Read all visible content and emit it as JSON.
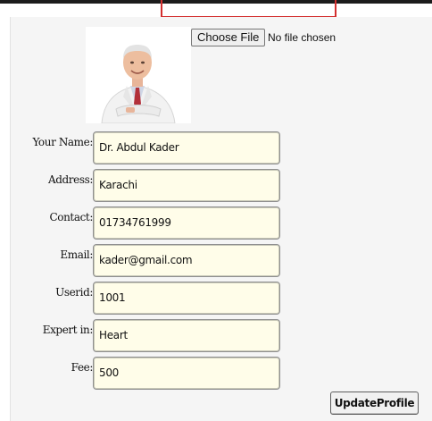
{
  "profile": {
    "choose_file_label": "Choose File",
    "file_status": "No file chosen"
  },
  "form": {
    "fields": [
      {
        "label": "Your Name:",
        "value": "Dr. Abdul Kader"
      },
      {
        "label": "Address:",
        "value": "Karachi"
      },
      {
        "label": "Contact:",
        "value": "01734761999"
      },
      {
        "label": "Email:",
        "value": "kader@gmail.com"
      },
      {
        "label": "Userid:",
        "value": "1001"
      },
      {
        "label": "Expert in:",
        "value": "Heart"
      },
      {
        "label": "Fee:",
        "value": "500"
      }
    ],
    "submit_label": "UpdateProfile"
  },
  "colors": {
    "field_background": "#fffde9",
    "panel_background": "#f5f5f5",
    "focus_outline": "#d32f2f"
  },
  "icons": {
    "avatar": "doctor-portrait"
  }
}
